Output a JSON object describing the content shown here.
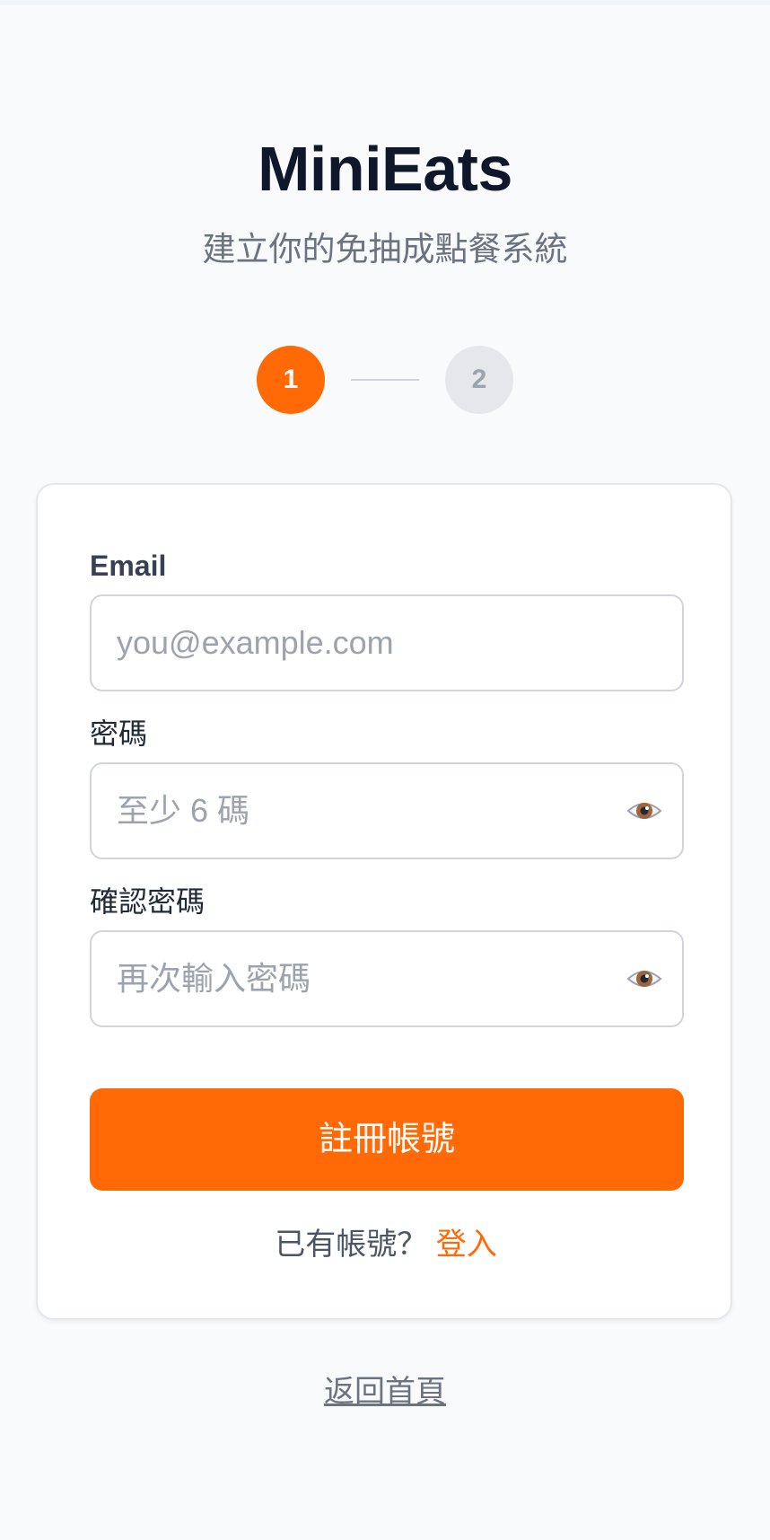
{
  "app": {
    "title": "MiniEats",
    "subtitle": "建立你的免抽成點餐系統"
  },
  "stepper": {
    "steps": [
      {
        "label": "1",
        "state": "active"
      },
      {
        "label": "2",
        "state": "inactive"
      }
    ]
  },
  "form": {
    "email": {
      "label": "Email",
      "value": "",
      "placeholder": "you@example.com"
    },
    "password": {
      "label": "密碼",
      "value": "",
      "placeholder": "至少 6 碼",
      "icon": "eye-icon"
    },
    "confirm_password": {
      "label": "確認密碼",
      "value": "",
      "placeholder": "再次輸入密碼",
      "icon": "eye-icon"
    },
    "submit_label": "註冊帳號",
    "login_prompt": "已有帳號？",
    "login_link": "登入"
  },
  "footer": {
    "back_home": "返回首頁"
  },
  "colors": {
    "accent": "#ff6a06",
    "title": "#0f172a",
    "background": "#f8fafc",
    "inactive_step": "#e5e7eb"
  }
}
